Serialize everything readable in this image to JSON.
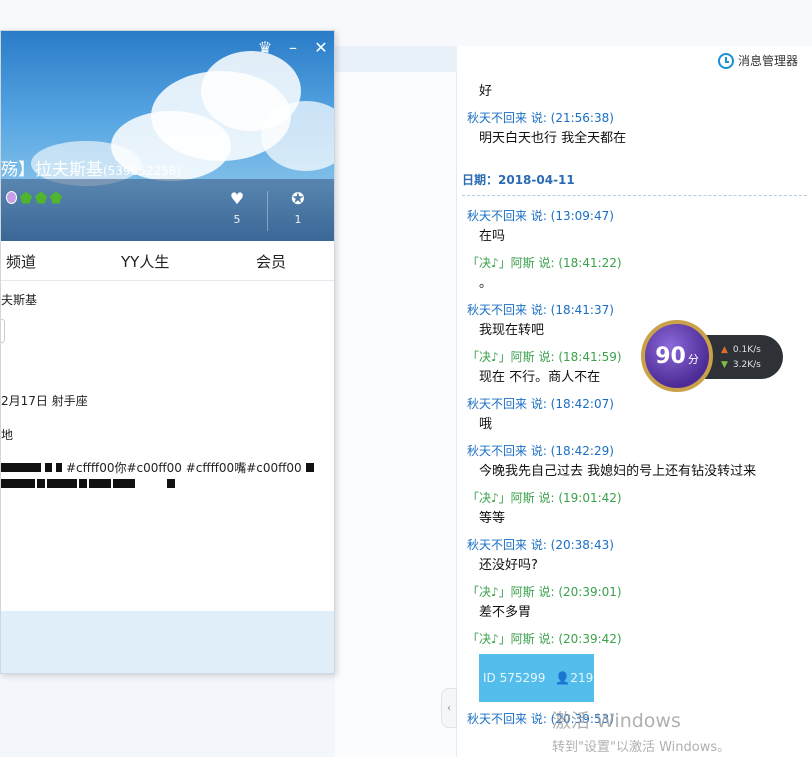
{
  "chat": {
    "manager_label": "消息管理器",
    "date_label": "日期：2018-04-11",
    "messages_before_date": [
      {
        "sender": "",
        "color": "blue",
        "text": "好"
      },
      {
        "sender": "秋天不回来 说: (21:56:38)",
        "color": "blue",
        "text": "明天白天也行 我全天都在"
      }
    ],
    "messages": [
      {
        "sender": "秋天不回来 说: (13:09:47)",
        "color": "blue",
        "text": "在吗"
      },
      {
        "sender": "「决♪」阿斯 说: (18:41:22)",
        "color": "green",
        "text": "。"
      },
      {
        "sender": "秋天不回来 说: (18:41:37)",
        "color": "blue",
        "text": "我现在转吧"
      },
      {
        "sender": "「决♪」阿斯 说: (18:41:59)",
        "color": "green",
        "text": "现在 不行。商人不在"
      },
      {
        "sender": "秋天不回来 说: (18:42:07)",
        "color": "blue",
        "text": "哦"
      },
      {
        "sender": "秋天不回来 说: (18:42:29)",
        "color": "blue",
        "text": "今晚我先自己过去 我媳妇的号上还有钻没转过来"
      },
      {
        "sender": "「决♪」阿斯 说: (19:01:42)",
        "color": "green",
        "text": "等等"
      },
      {
        "sender": "秋天不回来 说: (20:38:43)",
        "color": "blue",
        "text": "还没好吗?"
      },
      {
        "sender": "「决♪」阿斯 说: (20:39:01)",
        "color": "green",
        "text": "差不多胃"
      },
      {
        "sender": "「决♪」阿斯 说: (20:39:42)",
        "color": "green",
        "text": ""
      }
    ],
    "card": {
      "id_text": "ID 575299",
      "members": "219"
    },
    "last_sender": "秋天不回来 说: (20:39:53)"
  },
  "speed_widget": {
    "score": "90",
    "unit": "分",
    "up": "0.1K/s",
    "down": "3.2K/s"
  },
  "watermark": {
    "title": "激活 Windows",
    "subtitle": "转到\"设置\"以激活 Windows。"
  },
  "profile": {
    "display_name": "殇】拉夫斯基",
    "uid": "(539852258)",
    "likes": "5",
    "awards": "1",
    "tabs": [
      "频道",
      "YY人生",
      "会员"
    ],
    "info_name": "夫斯基",
    "birthday": "2月17日   射手座",
    "location": "地",
    "signature": "#cffff00你#c00ff00 #cffff00嘴#c00ff00"
  },
  "colors": {
    "accent_blue": "#1a6fc5",
    "accent_green": "#3aa14b",
    "card_bg": "#53bdeb"
  }
}
